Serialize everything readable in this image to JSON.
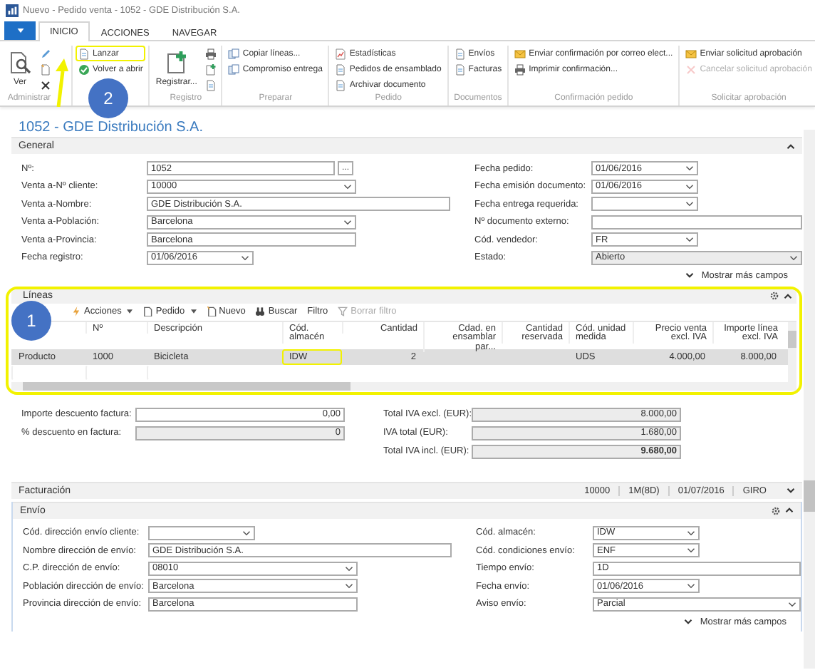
{
  "window": {
    "title": "Nuevo - Pedido venta - 1052 - GDE Distribución S.A."
  },
  "tabs": [
    {
      "label": "INICIO",
      "selected": true
    },
    {
      "label": "ACCIONES",
      "selected": false
    },
    {
      "label": "NAVEGAR",
      "selected": false
    }
  ],
  "ribbon": [
    {
      "label": "Administrar",
      "items": [
        {
          "kind": "large",
          "label": "Ver",
          "disabled": false,
          "highlighted": false
        },
        {
          "kind": "icon",
          "disabled": false,
          "highlighted": false
        },
        {
          "kind": "icon",
          "disabled": false,
          "highlighted": false
        },
        {
          "kind": "icon",
          "disabled": false,
          "highlighted": false
        }
      ]
    },
    {
      "items": [
        {
          "kind": "small",
          "label": "Lanzar",
          "disabled": false,
          "highlighted": true
        },
        {
          "kind": "small",
          "label": "Volver a abrir",
          "disabled": false,
          "highlighted": false
        }
      ]
    },
    {
      "label": "Registro",
      "items": [
        {
          "kind": "large",
          "label": "Registrar...",
          "disabled": false,
          "highlighted": false
        },
        {
          "kind": "icon",
          "disabled": false,
          "highlighted": false
        },
        {
          "kind": "icon",
          "disabled": false,
          "highlighted": false
        },
        {
          "kind": "icon",
          "disabled": false,
          "highlighted": false
        }
      ]
    },
    {
      "label": "Preparar",
      "items": [
        {
          "kind": "small",
          "label": "Copiar líneas...",
          "disabled": false,
          "highlighted": false
        },
        {
          "kind": "small",
          "label": "Compromiso entrega",
          "disabled": false,
          "highlighted": false
        }
      ]
    },
    {
      "label": "Pedido",
      "items": [
        {
          "kind": "small",
          "label": "Estadísticas",
          "disabled": false,
          "highlighted": false
        },
        {
          "kind": "small",
          "label": "Pedidos de ensamblado",
          "disabled": false,
          "highlighted": false
        },
        {
          "kind": "small",
          "label": "Archivar documento",
          "disabled": false,
          "highlighted": false
        }
      ]
    },
    {
      "label": "Documentos",
      "items": [
        {
          "kind": "small",
          "label": "Envíos",
          "disabled": false,
          "highlighted": false
        },
        {
          "kind": "small",
          "label": "Facturas",
          "disabled": false,
          "highlighted": false
        }
      ]
    },
    {
      "label": "Confirmación pedido",
      "items": [
        {
          "kind": "small",
          "label": "Enviar confirmación por correo elect...",
          "disabled": false,
          "highlighted": false
        },
        {
          "kind": "small",
          "label": "Imprimir confirmación...",
          "disabled": false,
          "highlighted": false
        }
      ]
    },
    {
      "label": "Solicitar aprobación",
      "items": [
        {
          "kind": "small",
          "label": "Enviar solicitud aprobación",
          "disabled": false,
          "highlighted": false
        },
        {
          "kind": "small",
          "label": "Cancelar solicitud aprobación",
          "disabled": true,
          "highlighted": false
        }
      ]
    }
  ],
  "page_title": "1052 - GDE Distribución S.A.",
  "general": {
    "title": "General",
    "expanded": true,
    "more": "Mostrar más campos",
    "left": [
      {
        "label": "Nº:",
        "value": "1052",
        "kind": "text",
        "button": "...",
        "readonly": false
      },
      {
        "label": "Venta a-Nº cliente:",
        "value": "10000",
        "kind": "dropdown",
        "readonly": false
      },
      {
        "label": "Venta a-Nombre:",
        "value": "GDE Distribución S.A.",
        "kind": "text",
        "readonly": false
      },
      {
        "label": "Venta a-Población:",
        "value": "Barcelona",
        "kind": "dropdown",
        "readonly": false
      },
      {
        "label": "Venta a-Provincia:",
        "value": "Barcelona",
        "kind": "text",
        "readonly": false
      },
      {
        "label": "Fecha registro:",
        "value": "01/06/2016",
        "kind": "dropdown",
        "readonly": false
      }
    ],
    "right": [
      {
        "label": "Fecha pedido:",
        "value": "01/06/2016",
        "kind": "dropdown",
        "readonly": false
      },
      {
        "label": "Fecha emisión documento:",
        "value": "01/06/2016",
        "kind": "dropdown",
        "readonly": false
      },
      {
        "label": "Fecha entrega requerida:",
        "kind": "dropdown",
        "readonly": false
      },
      {
        "label": "Nº documento externo:",
        "kind": "text",
        "readonly": false
      },
      {
        "label": "Cód. vendedor:",
        "value": "FR",
        "kind": "dropdown",
        "readonly": false
      },
      {
        "label": "Estado:",
        "value": "Abierto",
        "kind": "dropdown",
        "readonly": true
      }
    ]
  },
  "lines": {
    "title": "Líneas",
    "expanded": true,
    "highlighted": true,
    "toolbar": [
      {
        "label": "Acciones",
        "menu": true,
        "disabled": false
      },
      {
        "label": "Pedido",
        "menu": true,
        "disabled": false
      },
      {
        "label": "Nuevo",
        "menu": false,
        "disabled": false
      },
      {
        "label": "Buscar",
        "menu": false,
        "disabled": false
      },
      {
        "label": "Filtro",
        "menu": false,
        "disabled": false
      },
      {
        "label": "Borrar filtro",
        "menu": false,
        "disabled": true
      }
    ],
    "columns": [
      {},
      {
        "label": "Nº"
      },
      {
        "label": "Descripción"
      },
      {
        "label": "Cód. almacén"
      },
      {
        "label": "Cantidad"
      },
      {
        "label": "Cdad. en ensamblar par..."
      },
      {
        "label": "Cantidad reservada"
      },
      {
        "label": "Cód. unidad medida"
      },
      {
        "label": "Precio venta excl. IVA"
      },
      {
        "label": "Importe línea excl. IVA"
      }
    ],
    "rows": [
      {
        "selected": true,
        "cells": [
          {
            "text": "Producto",
            "highlighted": false
          },
          {
            "text": "1000",
            "highlighted": false
          },
          {
            "text": "Bicicleta",
            "highlighted": false
          },
          {
            "text": "IDW",
            "highlighted": true
          },
          {
            "text": "2",
            "highlighted": false
          },
          null,
          null,
          {
            "text": "UDS",
            "highlighted": false
          },
          {
            "text": "4.000,00",
            "highlighted": false
          },
          {
            "text": "8.000,00",
            "highlighted": false
          }
        ]
      }
    ]
  },
  "totals": {
    "left": [
      {
        "label": "Importe descuento factura:",
        "value": "0,00",
        "readonly": false,
        "emphasis": false
      },
      {
        "label": "% descuento en factura:",
        "value": "0",
        "readonly": true,
        "emphasis": false
      }
    ],
    "right": [
      {
        "label": "Total IVA excl. (EUR):",
        "value": "8.000,00",
        "readonly": true,
        "emphasis": false
      },
      {
        "label": "IVA total (EUR):",
        "value": "1.680,00",
        "readonly": true,
        "emphasis": false
      },
      {
        "label": "Total IVA incl. (EUR):",
        "value": "9.680,00",
        "readonly": true,
        "emphasis": true
      }
    ]
  },
  "billing": {
    "title": "Facturación",
    "expanded": false,
    "summary": [
      "10000",
      "1M(8D)",
      "01/07/2016",
      "GIRO"
    ]
  },
  "shipping": {
    "title": "Envío",
    "expanded": true,
    "more": "Mostrar más campos",
    "left": [
      {
        "label": "Cód. dirección envío cliente:",
        "kind": "dropdown",
        "readonly": false
      },
      {
        "label": "Nombre dirección de envío:",
        "value": "GDE Distribución S.A.",
        "kind": "text",
        "readonly": false
      },
      {
        "label": "C.P. dirección de envío:",
        "value": "08010",
        "kind": "dropdown",
        "readonly": false
      },
      {
        "label": "Población dirección de envío:",
        "value": "Barcelona",
        "kind": "dropdown",
        "readonly": false
      },
      {
        "label": "Provincia dirección de envío:",
        "value": "Barcelona",
        "kind": "text",
        "readonly": false
      }
    ],
    "right": [
      {
        "label": "Cód. almacén:",
        "value": "IDW",
        "kind": "dropdown",
        "readonly": false
      },
      {
        "label": "Cód. condiciones envío:",
        "value": "ENF",
        "kind": "dropdown",
        "readonly": false
      },
      {
        "label": "Tiempo envío:",
        "value": "1D",
        "kind": "text",
        "readonly": false
      },
      {
        "label": "Fecha envío:",
        "value": "01/06/2016",
        "kind": "dropdown",
        "readonly": false
      },
      {
        "label": "Aviso envío:",
        "value": "Parcial",
        "kind": "dropdown",
        "readonly": false
      }
    ]
  },
  "callouts": [
    {
      "number": "1"
    },
    {
      "number": "2"
    }
  ]
}
